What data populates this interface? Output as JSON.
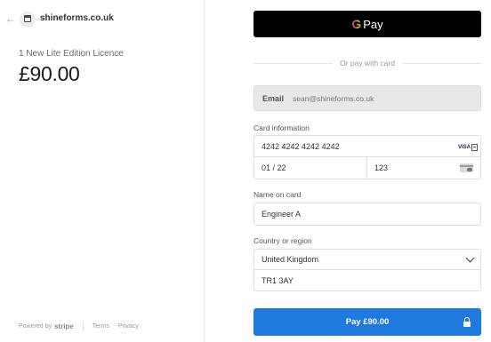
{
  "merchant": {
    "name": "shineforms.co.uk",
    "back_icon": "arrow-left-icon"
  },
  "order": {
    "product": "1 New Lite Edition Licence",
    "price": "£90.00"
  },
  "footer": {
    "powered_by": "Powered by",
    "brand": "stripe",
    "terms": "Terms",
    "privacy": "Privacy"
  },
  "gpay": {
    "g": "G",
    "label": "Pay"
  },
  "divider": {
    "text": "Or pay with card"
  },
  "email": {
    "label": "Email",
    "value": "sean@shineforms.co.uk"
  },
  "card": {
    "label": "Card information",
    "number": "4242 4242 4242 4242",
    "brand": "VISA",
    "expiry": "01 / 22",
    "cvc": "123"
  },
  "name": {
    "label": "Name on card",
    "value": "Engineer A"
  },
  "region": {
    "label": "Country or region",
    "country": "United Kingdom",
    "postal": "TR1 3AY"
  },
  "pay": {
    "label": "Pay £90.00"
  },
  "colors": {
    "pay_button": "#1f7ae0",
    "gpay_button": "#000000",
    "email_bg": "#e8e8e8"
  }
}
